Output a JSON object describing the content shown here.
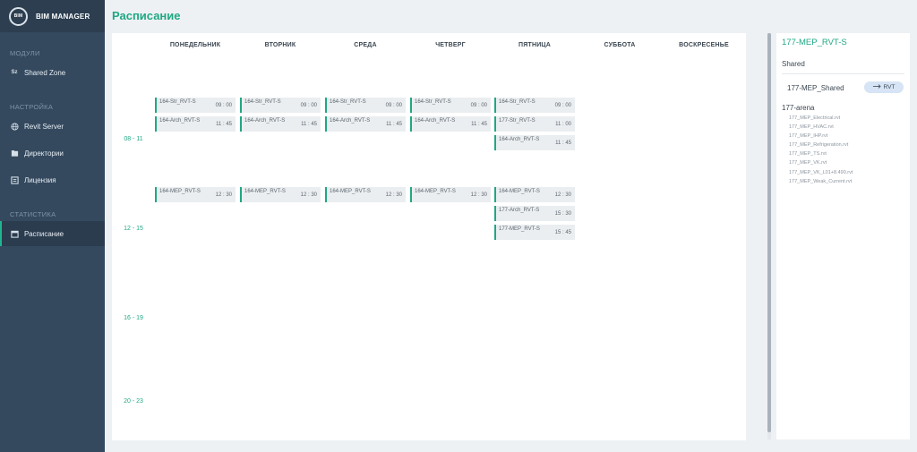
{
  "brand": {
    "logo_text": "BIM",
    "name": "BIM MANAGER"
  },
  "sidebar": {
    "sections": [
      {
        "label": "МОДУЛИ",
        "items": [
          {
            "label": "Shared Zone",
            "icon": "sz-icon"
          }
        ]
      },
      {
        "label": "НАСТРОЙКА",
        "items": [
          {
            "label": "Revit Server",
            "icon": "globe-icon"
          },
          {
            "label": "Директории",
            "icon": "folder-icon"
          },
          {
            "label": "Лицензия",
            "icon": "license-icon"
          }
        ]
      },
      {
        "label": "СТАТИСТИКА",
        "items": [
          {
            "label": "Расписание",
            "icon": "calendar-icon",
            "active": true
          }
        ]
      }
    ]
  },
  "page": {
    "title": "Расписание"
  },
  "schedule": {
    "days": [
      "ПОНЕДЕЛЬНИК",
      "ВТОРНИК",
      "СРЕДА",
      "ЧЕТВЕРГ",
      "ПЯТНИЦА",
      "СУББОТА",
      "ВОСКРЕСЕНЬЕ"
    ],
    "slots": [
      "",
      "08 - 11",
      "12 - 15",
      "16 - 19",
      "20 - 23"
    ],
    "events": [
      {
        "day": 0,
        "slot": 1,
        "row": 0,
        "name": "164-Str_RVT-S",
        "time": "09 : 00"
      },
      {
        "day": 0,
        "slot": 1,
        "row": 1,
        "name": "164-Arch_RVT-S",
        "time": "11 : 45"
      },
      {
        "day": 1,
        "slot": 1,
        "row": 0,
        "name": "164-Str_RVT-S",
        "time": "09 : 00"
      },
      {
        "day": 1,
        "slot": 1,
        "row": 1,
        "name": "164-Arch_RVT-S",
        "time": "11 : 45"
      },
      {
        "day": 2,
        "slot": 1,
        "row": 0,
        "name": "164-Str_RVT-S",
        "time": "09 : 00"
      },
      {
        "day": 2,
        "slot": 1,
        "row": 1,
        "name": "164-Arch_RVT-S",
        "time": "11 : 45"
      },
      {
        "day": 3,
        "slot": 1,
        "row": 0,
        "name": "164-Str_RVT-S",
        "time": "09 : 00"
      },
      {
        "day": 3,
        "slot": 1,
        "row": 1,
        "name": "164-Arch_RVT-S",
        "time": "11 : 45"
      },
      {
        "day": 4,
        "slot": 1,
        "row": 0,
        "name": "164-Str_RVT-S",
        "time": "09 : 00"
      },
      {
        "day": 4,
        "slot": 1,
        "row": 1,
        "name": "177-Str_RVT-S",
        "time": "11 : 00"
      },
      {
        "day": 4,
        "slot": 1,
        "row": 2,
        "name": "164-Arch_RVT-S",
        "time": "11 : 45"
      },
      {
        "day": 0,
        "slot": 2,
        "row": 0,
        "name": "164-MEP_RVT-S",
        "time": "12 : 30"
      },
      {
        "day": 1,
        "slot": 2,
        "row": 0,
        "name": "164-MEP_RVT-S",
        "time": "12 : 30"
      },
      {
        "day": 2,
        "slot": 2,
        "row": 0,
        "name": "164-MEP_RVT-S",
        "time": "12 : 30"
      },
      {
        "day": 3,
        "slot": 2,
        "row": 0,
        "name": "164-MEP_RVT-S",
        "time": "12 : 30"
      },
      {
        "day": 4,
        "slot": 2,
        "row": 0,
        "name": "164-MEP_RVT-S",
        "time": "12 : 30"
      },
      {
        "day": 4,
        "slot": 2,
        "row": 1,
        "name": "177-Arch_RVT-S",
        "time": "15 : 30"
      },
      {
        "day": 4,
        "slot": 2,
        "row": 2,
        "name": "177-MEP_RVT-S",
        "time": "15 : 45"
      }
    ]
  },
  "right_panel": {
    "title": "177-MEP_RVT-S",
    "shared_label": "Shared",
    "shared_item": "177-MEP_Shared",
    "rvt_button": "RVT",
    "group_label": "177-arena",
    "files": [
      "177_MEP_Electrical.rvt",
      "177_MEP_HVAC.rvt",
      "177_MEP_IHP.rvt",
      "177_MEP_Refrigeration.rvt",
      "177_MEP_TS.rvt",
      "177_MEP_VK.rvt",
      "177_MEP_VK_L01+8.490.rvt",
      "177_MEP_Weak_Current.rvt"
    ]
  },
  "colors": {
    "accent": "#1fa883",
    "sidebar": "#34495e",
    "brand_bar": "#2c3e50",
    "event_bg": "#ebeef0"
  }
}
